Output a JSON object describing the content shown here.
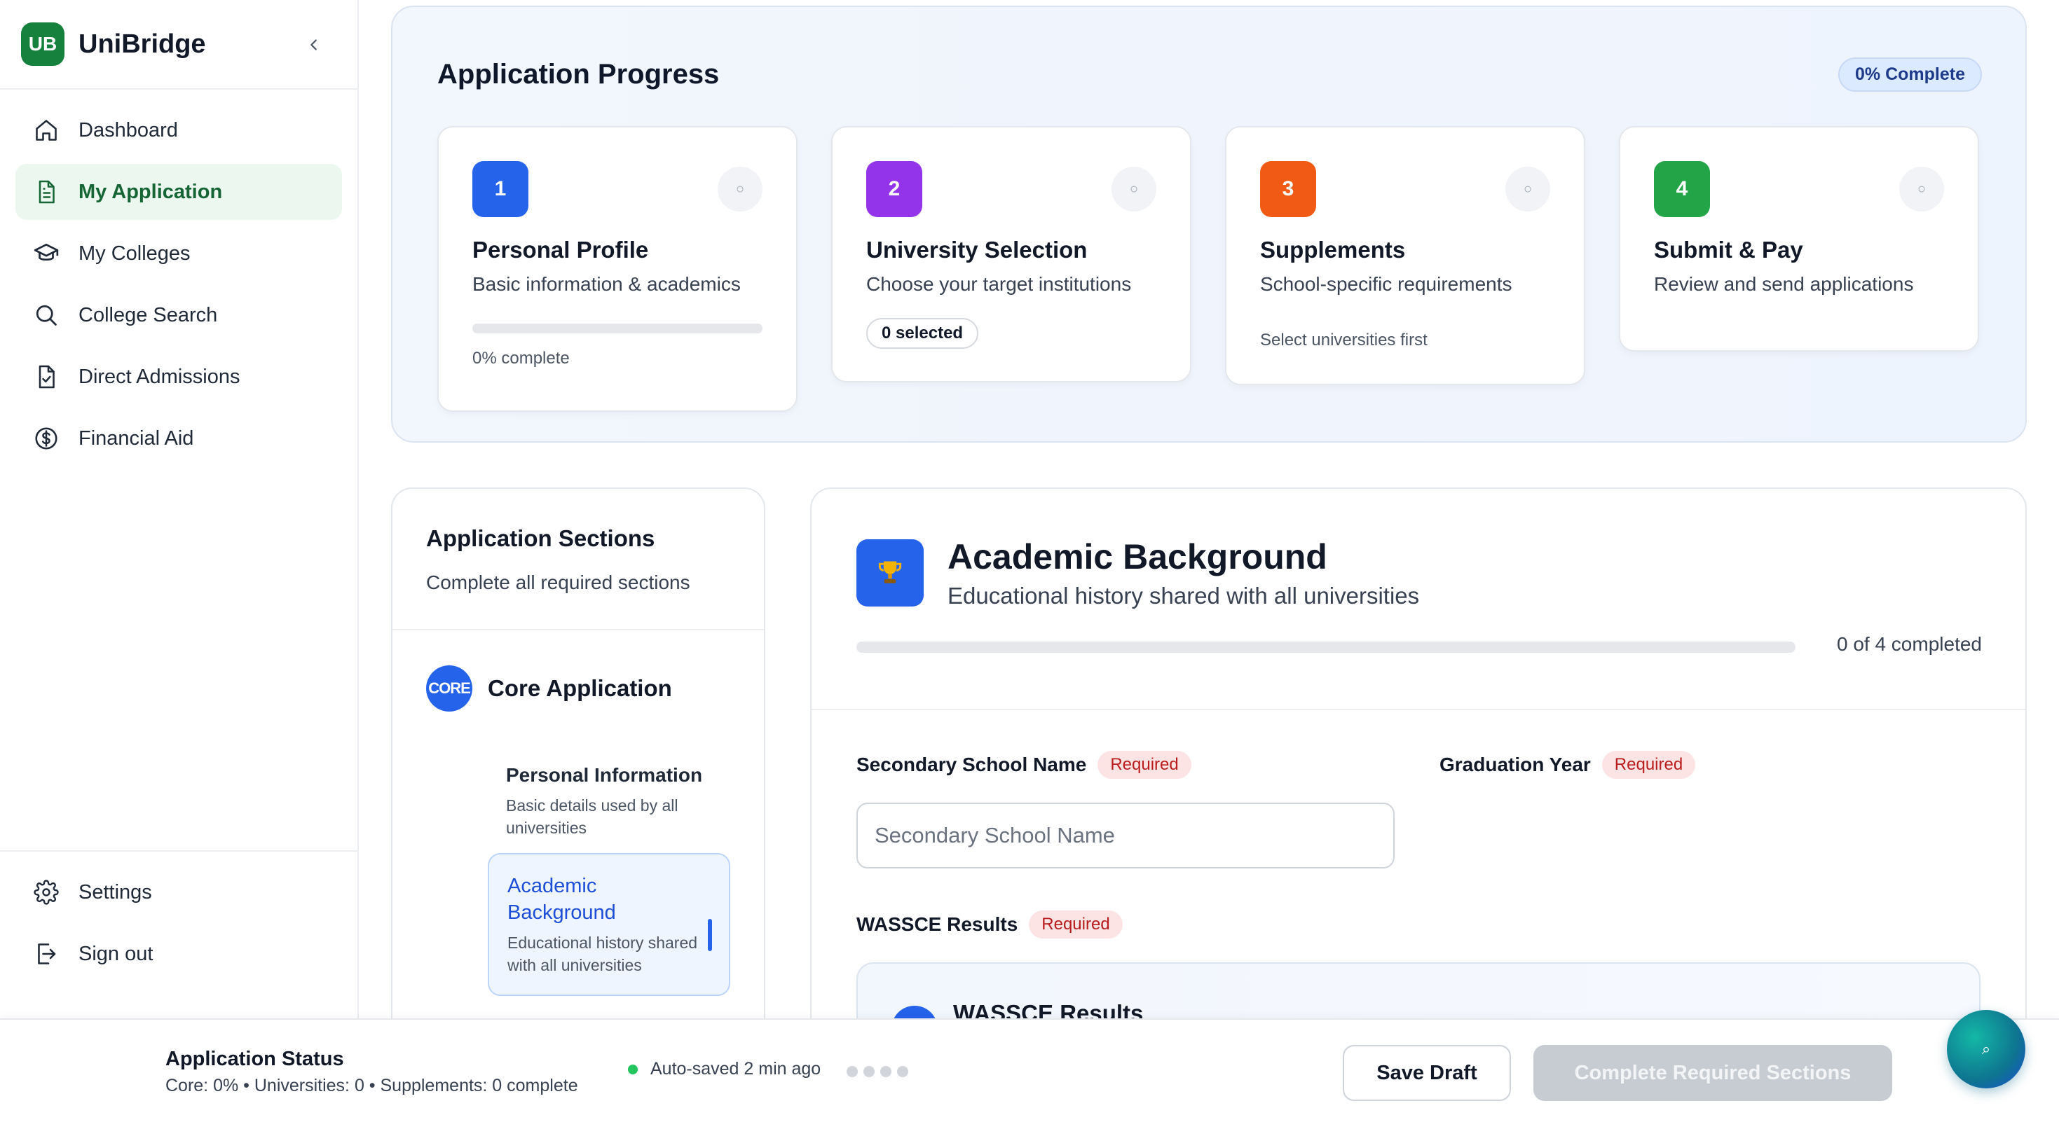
{
  "brand": {
    "logo": "UB",
    "name": "UniBridge"
  },
  "sidebar": {
    "items": [
      {
        "label": "Dashboard",
        "icon": "home-icon",
        "active": false
      },
      {
        "label": "My Application",
        "icon": "document-icon",
        "active": true
      },
      {
        "label": "My Colleges",
        "icon": "graduation-cap-icon",
        "active": false
      },
      {
        "label": "College Search",
        "icon": "search-icon",
        "active": false
      },
      {
        "label": "Direct Admissions",
        "icon": "file-check-icon",
        "active": false
      },
      {
        "label": "Financial Aid",
        "icon": "dollar-icon",
        "active": false
      }
    ],
    "bottom": [
      {
        "label": "Settings",
        "icon": "gear-icon"
      },
      {
        "label": "Sign out",
        "icon": "sign-out-icon"
      }
    ]
  },
  "progress": {
    "title": "Application Progress",
    "badge": "0% Complete",
    "steps": [
      {
        "num": "1",
        "title": "Personal Profile",
        "desc": "Basic information & academics",
        "meta": "0% complete",
        "progress": 0,
        "color": "#2563eb"
      },
      {
        "num": "2",
        "title": "University Selection",
        "desc": "Choose your target institutions",
        "pill": "0 selected",
        "color": "#9333ea"
      },
      {
        "num": "3",
        "title": "Supplements",
        "desc": "School-specific requirements",
        "note": "Select universities first",
        "color": "#f05a14"
      },
      {
        "num": "4",
        "title": "Submit & Pay",
        "desc": "Review and send applications",
        "color": "#22a447"
      }
    ],
    "check_glyph": "○"
  },
  "sections": {
    "title": "Application Sections",
    "subtitle": "Complete all required sections",
    "core_badge": "CORE",
    "core_label": "Core Application",
    "items": [
      {
        "title": "Personal Information",
        "desc": "Basic details used by all universities"
      },
      {
        "title": "Academic Background",
        "desc": "Educational history shared with all universities",
        "active": true
      }
    ]
  },
  "form": {
    "title": "Academic Background",
    "subtitle": "Educational history shared with all universities",
    "icon": "trophy-icon",
    "count": "0 of 4 completed",
    "progress": 0,
    "required_label": "Required",
    "school_label": "Secondary School Name",
    "school_placeholder": "Secondary School Name",
    "school_value": "",
    "grad_label": "Graduation Year",
    "wassce_label": "WASSCE Results",
    "wassce_box_title": "WASSCE Results"
  },
  "footer": {
    "title": "Application Status",
    "summary": "Core: 0% • Universities: 0 • Supplements: 0 complete",
    "saved": "Auto-saved 2 min ago",
    "save_draft": "Save Draft",
    "complete": "Complete Required Sections",
    "fab_glyph": "⌕"
  }
}
